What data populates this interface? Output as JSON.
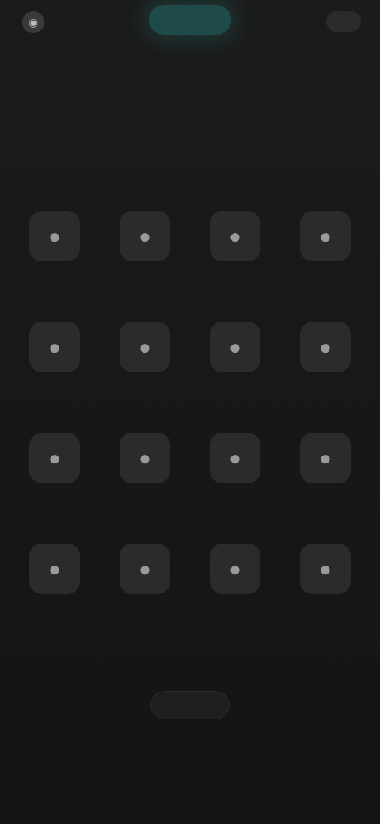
{
  "topbar": {
    "logo_text": "",
    "toggle_label": "",
    "right_text": "",
    "right_button_label": "",
    "sub_link": ""
  },
  "header": {
    "title": "",
    "subtitle": ""
  },
  "grid": {
    "items": [
      {
        "icon": "app-icon",
        "label": ""
      },
      {
        "icon": "app-icon",
        "label": ""
      },
      {
        "icon": "app-icon",
        "label": ""
      },
      {
        "icon": "app-icon",
        "label": ""
      },
      {
        "icon": "app-icon",
        "label": ""
      },
      {
        "icon": "app-icon",
        "label": ""
      },
      {
        "icon": "app-icon",
        "label": ""
      },
      {
        "icon": "app-icon",
        "label": ""
      },
      {
        "icon": "app-icon",
        "label": ""
      },
      {
        "icon": "app-icon",
        "label": ""
      },
      {
        "icon": "app-icon",
        "label": ""
      },
      {
        "icon": "app-icon",
        "label": ""
      },
      {
        "icon": "app-icon",
        "label": ""
      },
      {
        "icon": "app-icon",
        "label": ""
      },
      {
        "icon": "app-icon",
        "label": ""
      },
      {
        "icon": "app-icon",
        "label": ""
      }
    ]
  },
  "footer": {
    "more_label": ""
  },
  "colors": {
    "background": "#161616",
    "accent": "#1e4a48",
    "tile": "#2a2c2c"
  }
}
